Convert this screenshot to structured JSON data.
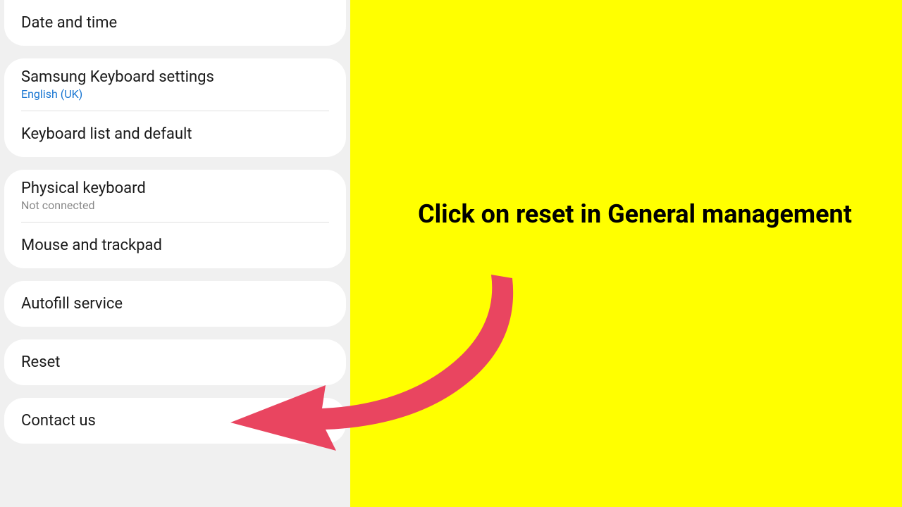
{
  "settings": {
    "dateTime": {
      "title": "Date and time"
    },
    "keyboard": {
      "samsungKeyboard": {
        "title": "Samsung Keyboard settings",
        "subtitle": "English (UK)"
      },
      "keyboardList": {
        "title": "Keyboard list and default"
      }
    },
    "input": {
      "physicalKeyboard": {
        "title": "Physical keyboard",
        "subtitle": "Not connected"
      },
      "mouseTrackpad": {
        "title": "Mouse and trackpad"
      }
    },
    "autofill": {
      "title": "Autofill service"
    },
    "reset": {
      "title": "Reset"
    },
    "contactUs": {
      "title": "Contact us"
    }
  },
  "instruction": {
    "text": "Click on reset in General management"
  },
  "colors": {
    "arrow": "#e94560",
    "highlight": "#ffff00"
  }
}
